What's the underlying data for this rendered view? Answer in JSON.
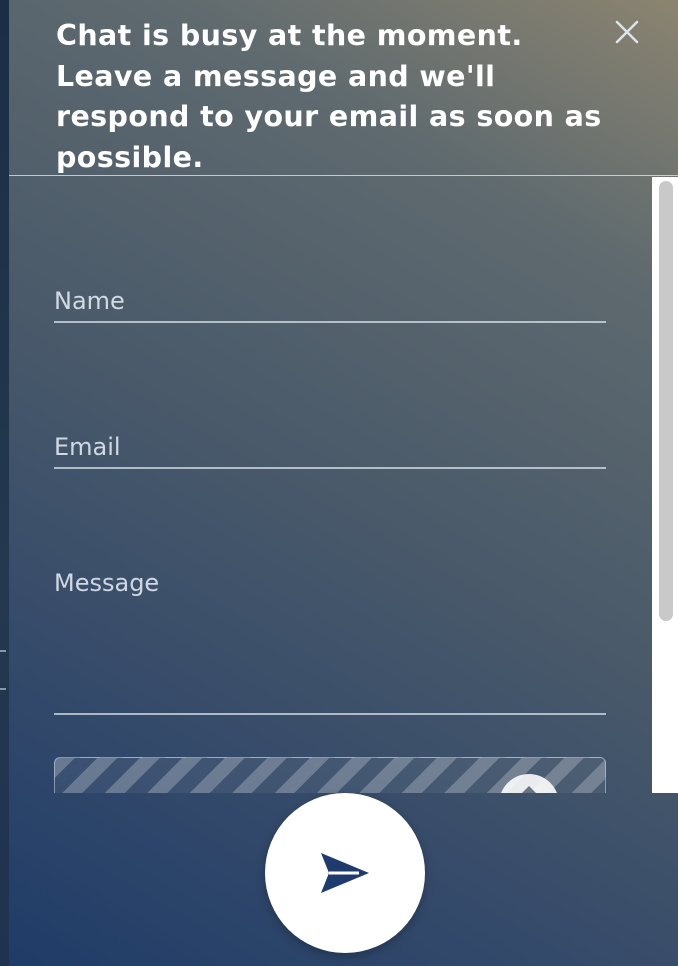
{
  "header": {
    "title": "Chat is busy at the moment. Leave a message and we'll respond to your email as soon as possible."
  },
  "form": {
    "name_placeholder": "Name",
    "name_value": "",
    "email_placeholder": "Email",
    "email_value": "",
    "message_placeholder": "Message",
    "message_value": ""
  },
  "icons": {
    "close": "close-icon",
    "upload": "cloud-upload-icon",
    "send": "send-icon"
  },
  "colors": {
    "send_icon": "#1f3b6e",
    "text": "#ffffff"
  }
}
